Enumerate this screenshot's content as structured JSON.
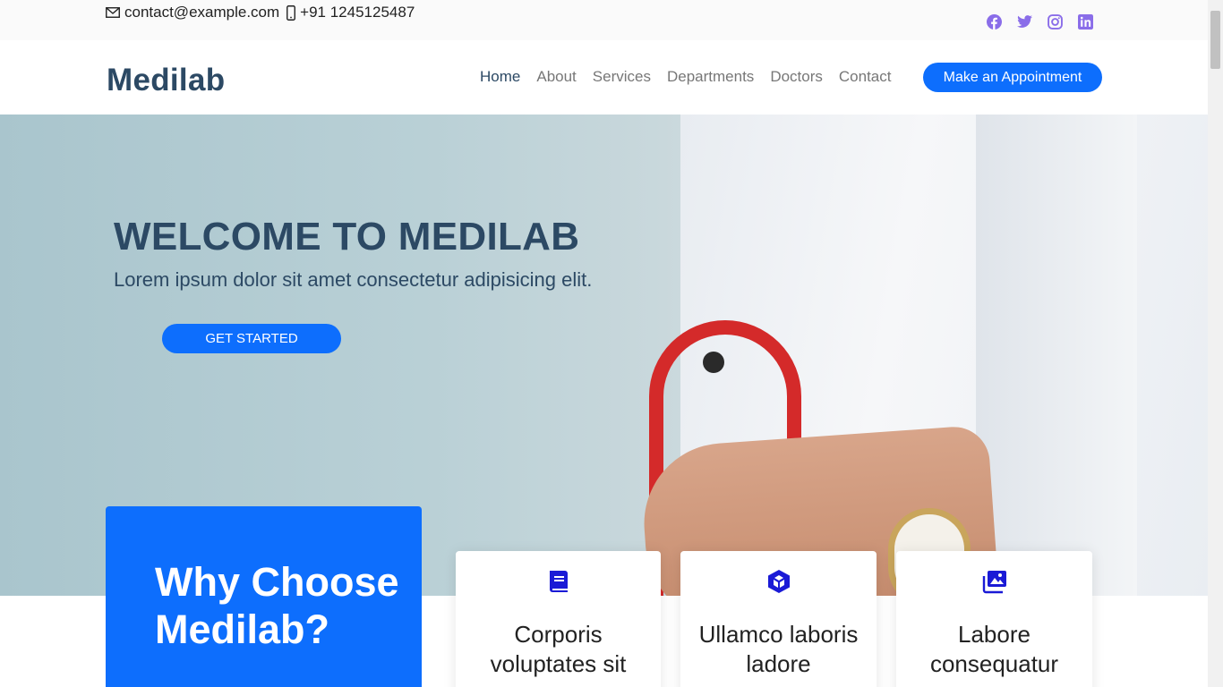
{
  "topbar": {
    "email": "contact@example.com",
    "phone": "+91 1245125487",
    "socials": [
      "facebook-icon",
      "twitter-icon",
      "instagram-icon",
      "linkedin-icon"
    ],
    "social_color": "#8a6de9"
  },
  "header": {
    "logo": "Medilab",
    "nav": [
      "Home",
      "About",
      "Services",
      "Departments",
      "Doctors",
      "Contact"
    ],
    "active_nav": "Home",
    "appointment_label": "Make an Appointment"
  },
  "hero": {
    "title": "WELCOME TO MEDILAB",
    "subtitle": "Lorem ipsum dolor sit amet consectetur adipisicing elit.",
    "cta_label": "GET STARTED"
  },
  "why": {
    "title": "Why Choose Medilab?"
  },
  "cards": [
    {
      "icon": "book-icon",
      "title": "Corporis voluptates sit"
    },
    {
      "icon": "cube-icon",
      "title": "Ullamco laboris ladore"
    },
    {
      "icon": "images-icon",
      "title": "Labore consequatur"
    }
  ],
  "colors": {
    "accent": "#0d6efd",
    "heading": "#2c4964",
    "icon": "#1a1ad6"
  }
}
